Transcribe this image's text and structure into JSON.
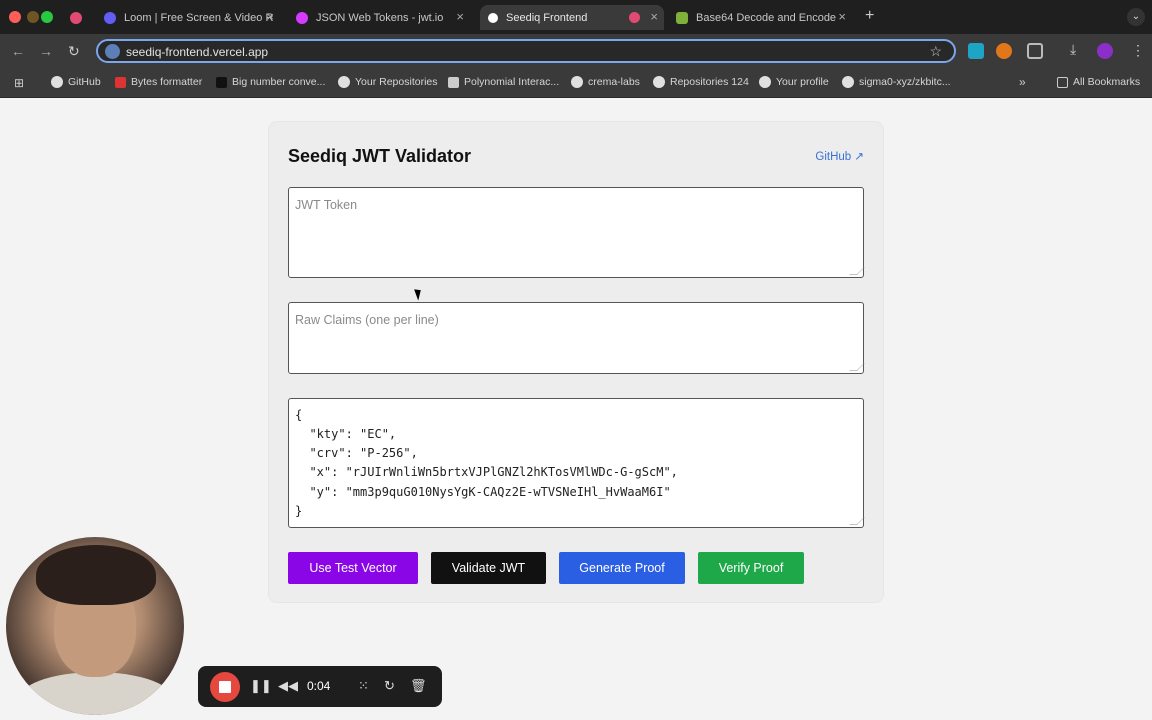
{
  "tabs": [
    {
      "label": "",
      "favicon_color": "#e14a73"
    },
    {
      "label": "Loom | Free Screen & Video R",
      "favicon_color": "#625df5"
    },
    {
      "label": "JSON Web Tokens - jwt.io",
      "favicon_color": "#d63aff"
    },
    {
      "label": "Seediq Frontend",
      "favicon_color": "#ffffff"
    },
    {
      "label": "Base64 Decode and Encode",
      "favicon_color": "#7fb03a"
    }
  ],
  "address_bar": {
    "url": "seediq-frontend.vercel.app"
  },
  "bookmarks": [
    {
      "label": "GitHub"
    },
    {
      "label": "Bytes formatter"
    },
    {
      "label": "Big number conve..."
    },
    {
      "label": "Your Repositories"
    },
    {
      "label": "Polynomial Interac..."
    },
    {
      "label": "crema-labs"
    },
    {
      "label": "Repositories 124"
    },
    {
      "label": "Your profile"
    },
    {
      "label": "sigma0-xyz/zkbitc..."
    },
    {
      "label": "All Bookmarks"
    }
  ],
  "app": {
    "title": "Seediq JWT Validator",
    "github_link": "GitHub ↗",
    "jwt_placeholder": "JWT Token",
    "claims_placeholder": "Raw Claims (one per line)",
    "jwk_lines": [
      "{",
      "  \"kty\": \"EC\",",
      "  \"crv\": \"P-256\",",
      "  \"x\": \"rJUIrWnliWn5brtxVJPlGNZl2hKTosVMlWDc-G-gScM\",",
      "  \"y\": \"mm3p9quG010NysYgK-CAQz2E-wTVSNeIHl_HvWaaM6I\"",
      "}"
    ],
    "buttons": {
      "use_test_vector": "Use Test Vector",
      "validate_jwt": "Validate JWT",
      "generate_proof": "Generate Proof",
      "verify_proof": "Verify Proof"
    },
    "button_colors": {
      "use_test_vector": "#8a06e6",
      "validate_jwt": "#111111",
      "generate_proof": "#2b5fe3",
      "verify_proof": "#1fa84a"
    }
  },
  "recorder": {
    "time": "0:04"
  }
}
